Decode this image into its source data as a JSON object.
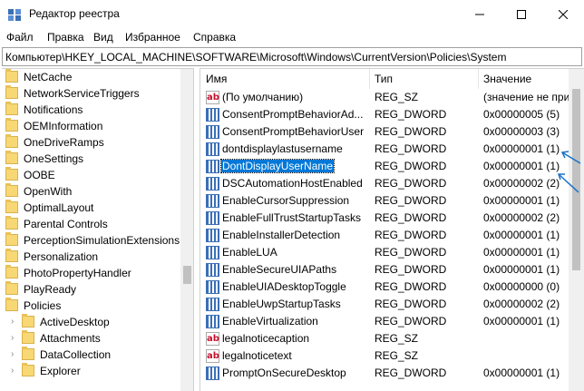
{
  "window": {
    "title": "Редактор реестра"
  },
  "menu": [
    "Файл",
    "Правка",
    "Вид",
    "Избранное",
    "Справка"
  ],
  "address": "Компьютер\\HKEY_LOCAL_MACHINE\\SOFTWARE\\Microsoft\\Windows\\CurrentVersion\\Policies\\System",
  "tree": [
    {
      "label": "NetCache",
      "level": 0
    },
    {
      "label": "NetworkServiceTriggers",
      "level": 0
    },
    {
      "label": "Notifications",
      "level": 0
    },
    {
      "label": "OEMInformation",
      "level": 0
    },
    {
      "label": "OneDriveRamps",
      "level": 0
    },
    {
      "label": "OneSettings",
      "level": 0
    },
    {
      "label": "OOBE",
      "level": 0
    },
    {
      "label": "OpenWith",
      "level": 0
    },
    {
      "label": "OptimalLayout",
      "level": 0
    },
    {
      "label": "Parental Controls",
      "level": 0
    },
    {
      "label": "PerceptionSimulationExtensions",
      "level": 0
    },
    {
      "label": "Personalization",
      "level": 0
    },
    {
      "label": "PhotoPropertyHandler",
      "level": 0
    },
    {
      "label": "PlayReady",
      "level": 0
    },
    {
      "label": "Policies",
      "level": 0
    },
    {
      "label": "ActiveDesktop",
      "level": 1
    },
    {
      "label": "Attachments",
      "level": 1
    },
    {
      "label": "DataCollection",
      "level": 1
    },
    {
      "label": "Explorer",
      "level": 1
    }
  ],
  "columns": {
    "name": "Имя",
    "type": "Тип",
    "data": "Значение"
  },
  "values": [
    {
      "name": "(По умолчанию)",
      "type": "REG_SZ",
      "data": "(значение не при",
      "icon": "string-value-icon"
    },
    {
      "name": "ConsentPromptBehaviorAd...",
      "type": "REG_DWORD",
      "data": "0x00000005 (5)",
      "icon": "dword-value-icon"
    },
    {
      "name": "ConsentPromptBehaviorUser",
      "type": "REG_DWORD",
      "data": "0x00000003 (3)",
      "icon": "dword-value-icon"
    },
    {
      "name": "dontdisplaylastusername",
      "type": "REG_DWORD",
      "data": "0x00000001 (1)",
      "icon": "dword-value-icon"
    },
    {
      "name": "DontDisplayUserName",
      "type": "REG_DWORD",
      "data": "0x00000001 (1)",
      "icon": "dword-value-icon",
      "selected": true
    },
    {
      "name": "DSCAutomationHostEnabled",
      "type": "REG_DWORD",
      "data": "0x00000002 (2)",
      "icon": "dword-value-icon"
    },
    {
      "name": "EnableCursorSuppression",
      "type": "REG_DWORD",
      "data": "0x00000001 (1)",
      "icon": "dword-value-icon"
    },
    {
      "name": "EnableFullTrustStartupTasks",
      "type": "REG_DWORD",
      "data": "0x00000002 (2)",
      "icon": "dword-value-icon"
    },
    {
      "name": "EnableInstallerDetection",
      "type": "REG_DWORD",
      "data": "0x00000001 (1)",
      "icon": "dword-value-icon"
    },
    {
      "name": "EnableLUA",
      "type": "REG_DWORD",
      "data": "0x00000001 (1)",
      "icon": "dword-value-icon"
    },
    {
      "name": "EnableSecureUIAPaths",
      "type": "REG_DWORD",
      "data": "0x00000001 (1)",
      "icon": "dword-value-icon"
    },
    {
      "name": "EnableUIADesktopToggle",
      "type": "REG_DWORD",
      "data": "0x00000000 (0)",
      "icon": "dword-value-icon"
    },
    {
      "name": "EnableUwpStartupTasks",
      "type": "REG_DWORD",
      "data": "0x00000002 (2)",
      "icon": "dword-value-icon"
    },
    {
      "name": "EnableVirtualization",
      "type": "REG_DWORD",
      "data": "0x00000001 (1)",
      "icon": "dword-value-icon"
    },
    {
      "name": "legalnoticecaption",
      "type": "REG_SZ",
      "data": "",
      "icon": "string-value-icon"
    },
    {
      "name": "legalnoticetext",
      "type": "REG_SZ",
      "data": "",
      "icon": "string-value-icon"
    },
    {
      "name": "PromptOnSecureDesktop",
      "type": "REG_DWORD",
      "data": "0x00000001 (1)",
      "icon": "dword-value-icon"
    }
  ],
  "colors": {
    "selection": "#0078d7",
    "arrow": "#1a73c8"
  }
}
